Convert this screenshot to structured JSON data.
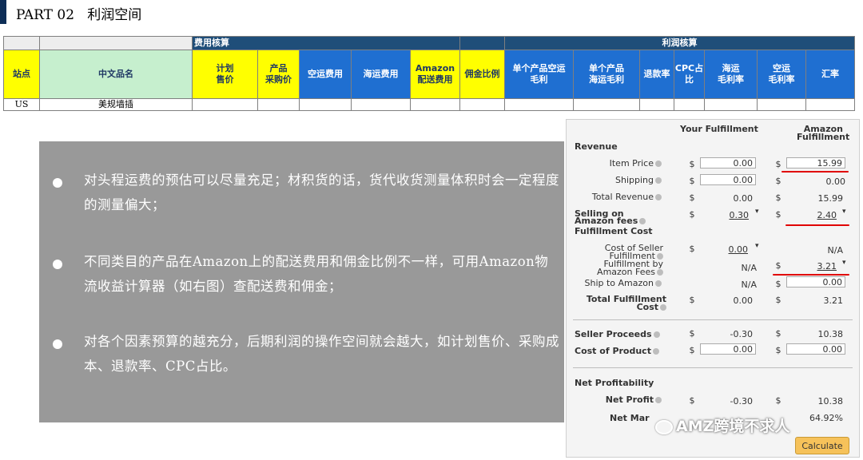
{
  "header": {
    "title": "PART 02   利润空间"
  },
  "sheet": {
    "group_headers": {
      "cost": "费用核算",
      "profit": "利润核算"
    },
    "columns": [
      "站点",
      "中文品名",
      "计划\n售价",
      "产品\n采购价",
      "空运费用",
      "海运费用",
      "Amazon\n配送费用",
      "佣金比例",
      "单个产品空运\n毛利",
      "单个产品\n海运毛利",
      "退款率",
      "CPC占\n比",
      "海运\n毛利率",
      "空运\n毛利率",
      "汇率"
    ],
    "row": {
      "site": "US",
      "name": "美规墙插"
    }
  },
  "bullets": [
    "对头程运费的预估可以尽量充足；材积货的话，货代收货测量体积时会一定程度的测量偏大；",
    "不同类目的产品在Amazon上的配送费用和佣金比例不一样，可用Amazon物流收益计算器（如右图）查配送费和佣金；",
    "对各个因素预算的越充分，后期利润的操作空间就会越大，如计划售价、采购成本、退款率、CPC占比。"
  ],
  "calculator": {
    "col_your": "Your Fulfillment",
    "col_amazon": "Amazon Fulfillment",
    "revenue": "Revenue",
    "item_price": "Item Price",
    "item_price_your": "0.00",
    "item_price_amz": "15.99",
    "shipping": "Shipping",
    "shipping_your": "0.00",
    "shipping_amz": "0.00",
    "total_revenue": "Total Revenue",
    "total_revenue_your": "0.00",
    "total_revenue_amz": "15.99",
    "selling_fees": "Selling on Amazon fees",
    "selling_fees_your": "0.30",
    "selling_fees_amz": "2.40",
    "fulfillment_cost": "Fulfillment Cost",
    "seller_fulfillment": "Cost of Seller Fulfillment",
    "seller_fulfillment_your": "0.00",
    "seller_fulfillment_amz": "N/A",
    "fba_fees": "Fulfillment by Amazon Fees",
    "fba_fees_your": "N/A",
    "fba_fees_amz": "3.21",
    "ship_to_amazon": "Ship to Amazon",
    "ship_to_amazon_your": "N/A",
    "ship_to_amazon_amz": "0.00",
    "total_fulfillment": "Total Fulfillment Cost",
    "total_fulfillment_your": "0.00",
    "total_fulfillment_amz": "3.21",
    "seller_proceeds": "Seller Proceeds",
    "seller_proceeds_your": "-0.30",
    "seller_proceeds_amz": "10.38",
    "cost_of_product": "Cost of Product",
    "cost_of_product_your": "0.00",
    "cost_of_product_amz": "0.00",
    "net_profitability": "Net Profitability",
    "net_profit": "Net Profit",
    "net_profit_your": "-0.30",
    "net_profit_amz": "10.38",
    "net_margin": "Net Mar",
    "net_margin_amz": "64.92%",
    "dollar": "$",
    "calculate": "Calculate"
  },
  "watermark": "AMZ跨境不求人",
  "colors": {
    "navy": "#1f4e79",
    "yellow": "#ffff00",
    "green": "#c6efce",
    "blue": "#1f6fd1",
    "panel": "#999999",
    "accent": "#0d2e57"
  }
}
